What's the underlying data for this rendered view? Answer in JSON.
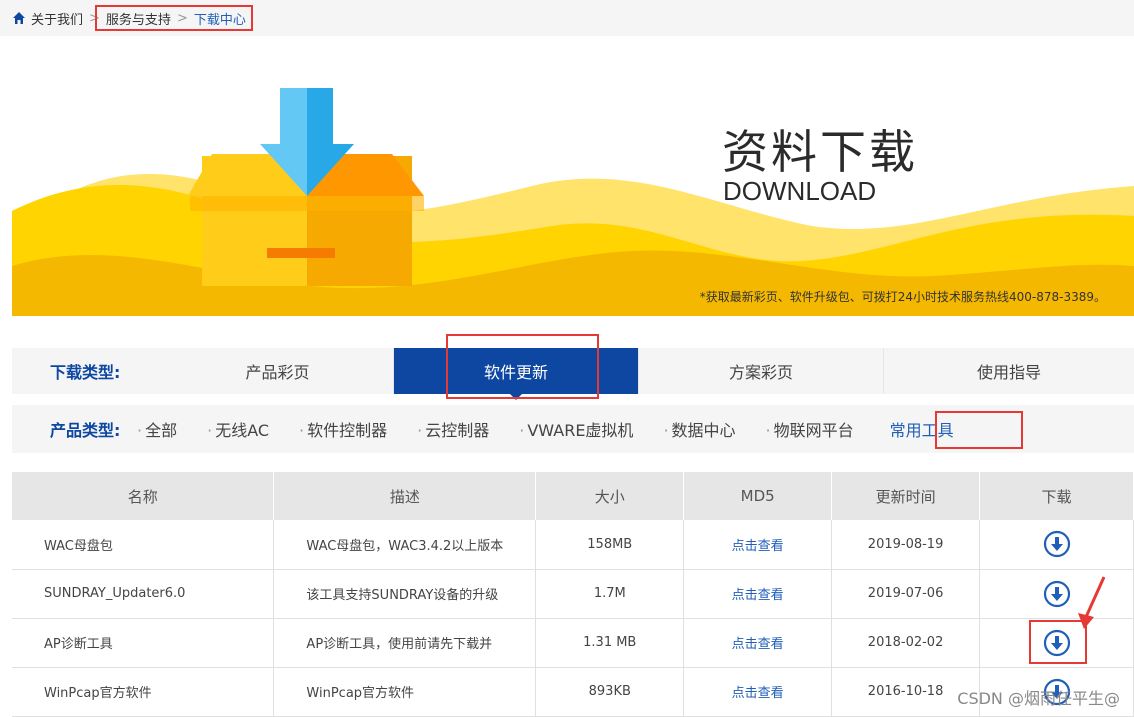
{
  "breadcrumb": {
    "home": "关于我们",
    "sep": ">",
    "service": "服务与支持",
    "current": "下载中心"
  },
  "banner": {
    "title": "资料下载",
    "subtitle": "DOWNLOAD",
    "note": "*获取最新彩页、软件升级包、可拨打24小时技术服务热线400-878-3389。"
  },
  "download_types": {
    "label": "下载类型:",
    "tabs": [
      "产品彩页",
      "软件更新",
      "方案彩页",
      "使用指导"
    ],
    "active": "软件更新"
  },
  "product_types": {
    "label": "产品类型:",
    "items": [
      "全部",
      "无线AC",
      "软件控制器",
      "云控制器",
      "VWARE虚拟机",
      "数据中心",
      "物联网平台",
      "常用工具"
    ],
    "active": "常用工具"
  },
  "table": {
    "headers": [
      "名称",
      "描述",
      "大小",
      "MD5",
      "更新时间",
      "下载"
    ],
    "rows": [
      {
        "name": "WAC母盘包",
        "desc": "WAC母盘包，WAC3.4.2以上版本",
        "size": "158MB",
        "md5": "点击查看",
        "date": "2019-08-19"
      },
      {
        "name": "SUNDRAY_Updater6.0",
        "desc": "该工具支持SUNDRAY设备的升级",
        "size": "1.7M",
        "md5": "点击查看",
        "date": "2019-07-06"
      },
      {
        "name": "AP诊断工具",
        "desc": "AP诊断工具，使用前请先下载并",
        "size": "1.31 MB",
        "md5": "点击查看",
        "date": "2018-02-02"
      },
      {
        "name": "WinPcap官方软件",
        "desc": "WinPcap官方软件",
        "size": "893KB",
        "md5": "点击查看",
        "date": "2016-10-18"
      }
    ]
  },
  "watermark": "CSDN @烟雨任平生@",
  "colors": {
    "brand": "#0d47a1",
    "highlight": "#e53935",
    "banner_yellow": "#ffd400"
  }
}
